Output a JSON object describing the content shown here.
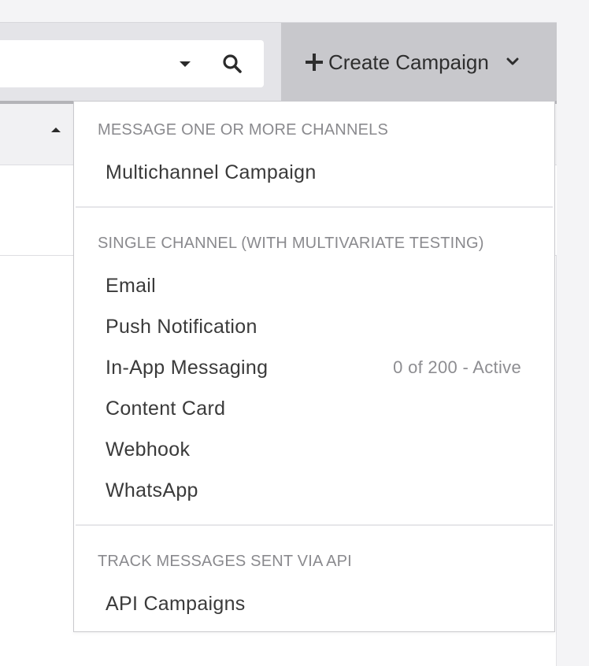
{
  "search": {
    "value": "",
    "placeholder": ""
  },
  "toolbar": {
    "create_label": "Create Campaign"
  },
  "dropdown": {
    "sections": [
      {
        "title": "MESSAGE ONE OR MORE CHANNELS",
        "items": [
          {
            "label": "Multichannel Campaign"
          }
        ]
      },
      {
        "title": "SINGLE CHANNEL (WITH MULTIVARIATE TESTING)",
        "items": [
          {
            "label": "Email"
          },
          {
            "label": "Push Notification"
          },
          {
            "label": "In-App Messaging",
            "meta": "0 of 200 - Active"
          },
          {
            "label": "Content Card"
          },
          {
            "label": "Webhook"
          },
          {
            "label": "WhatsApp"
          }
        ]
      },
      {
        "title": "TRACK MESSAGES SENT VIA API",
        "items": [
          {
            "label": "API Campaigns"
          }
        ]
      }
    ]
  },
  "icons": {
    "create": "plus-icon",
    "create_menu": "chevron-down-icon",
    "search": "search-icon",
    "search_filter": "caret-down-icon",
    "sort": "sort-ascending-icon"
  },
  "colors": {
    "toolbar_bg": "#e4e4e8",
    "button_bg": "#c8c8cc",
    "section_title": "#8a8a8e",
    "item_text": "#3a3a3a"
  }
}
